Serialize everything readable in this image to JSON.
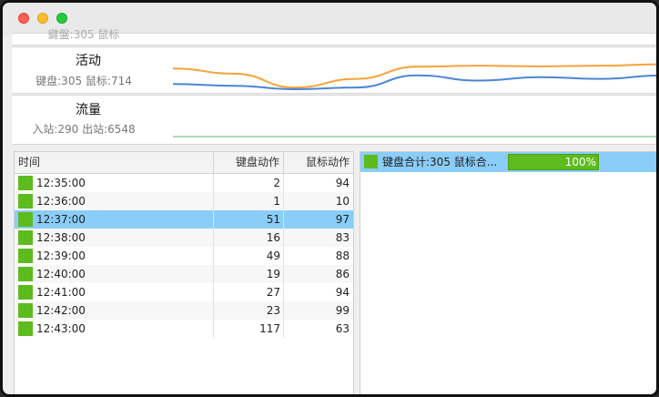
{
  "window": {
    "title": ""
  },
  "panels": {
    "top_partial": {
      "sub": "鍵盤:305 鼠标"
    },
    "activity": {
      "title": "活动",
      "sub": "键盘:305 鼠标:714"
    },
    "traffic": {
      "title": "流量",
      "sub": "入站:290 出站:6548"
    }
  },
  "activity_chart": {
    "type": "line",
    "series": [
      {
        "color": "#f7a23b",
        "values": [
          0.6,
          0.45,
          0.05,
          0.3,
          0.65,
          0.68,
          0.66,
          0.68,
          0.72
        ]
      },
      {
        "color": "#4a86d4",
        "values": [
          0.15,
          0.1,
          0.0,
          0.05,
          0.4,
          0.25,
          0.35,
          0.3,
          0.4
        ]
      }
    ]
  },
  "table": {
    "headers": {
      "time": "时间",
      "keyboard": "键盘动作",
      "mouse": "鼠标动作"
    },
    "selected_index": 2,
    "rows": [
      {
        "time": "12:35:00",
        "keyboard": "2",
        "mouse": "94"
      },
      {
        "time": "12:36:00",
        "keyboard": "1",
        "mouse": "10"
      },
      {
        "time": "12:37:00",
        "keyboard": "51",
        "mouse": "97"
      },
      {
        "time": "12:38:00",
        "keyboard": "16",
        "mouse": "83"
      },
      {
        "time": "12:39:00",
        "keyboard": "49",
        "mouse": "88"
      },
      {
        "time": "12:40:00",
        "keyboard": "19",
        "mouse": "86"
      },
      {
        "time": "12:41:00",
        "keyboard": "27",
        "mouse": "94"
      },
      {
        "time": "12:42:00",
        "keyboard": "23",
        "mouse": "99"
      },
      {
        "time": "12:43:00",
        "keyboard": "117",
        "mouse": "63"
      }
    ],
    "swatch_color": "#5dbb1e"
  },
  "summary": {
    "label": "键盘合计:305 鼠标合...",
    "percent_text": "100%",
    "percent": 100
  }
}
